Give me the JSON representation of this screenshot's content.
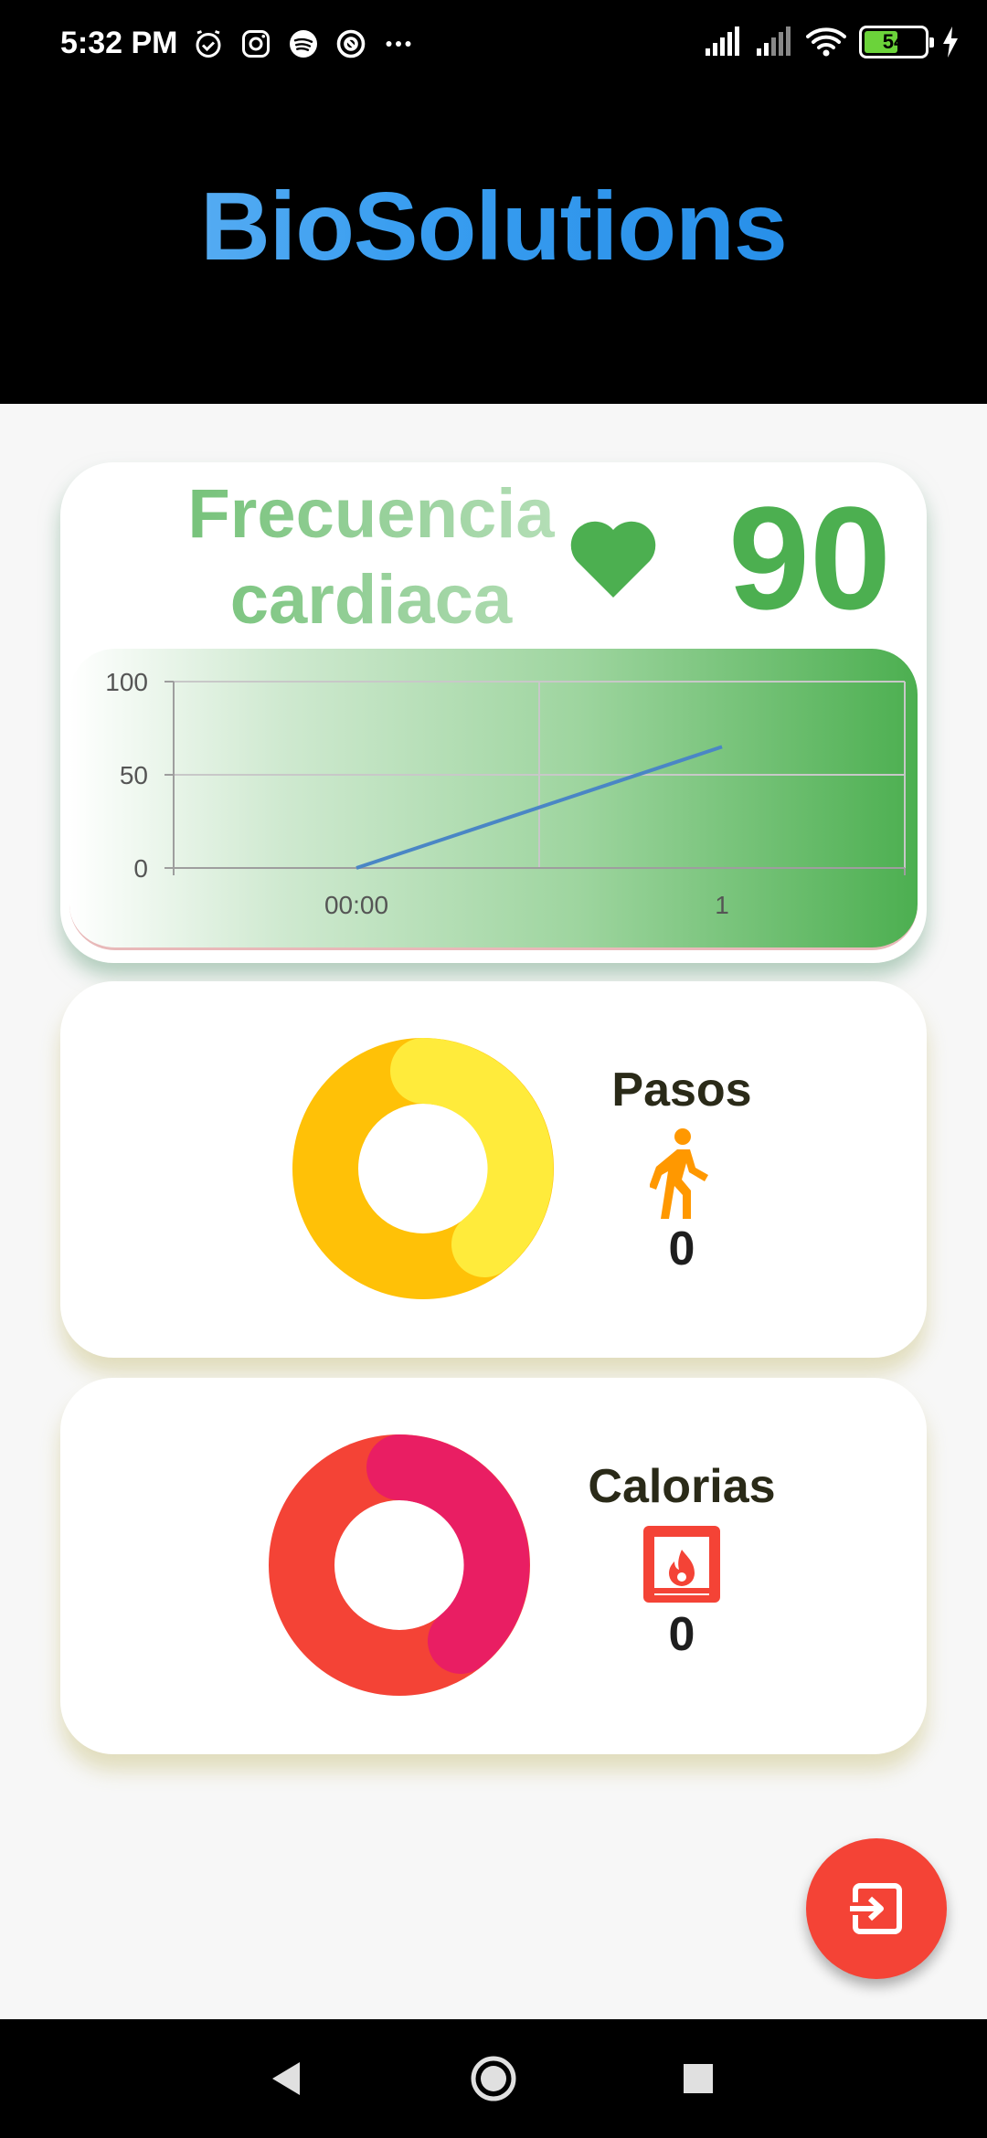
{
  "status_bar": {
    "time": "5:32 PM",
    "battery": "54",
    "icons_left": [
      "alarm-icon",
      "instagram-icon",
      "spotify-icon",
      "vpn-icon",
      "more-icon"
    ],
    "icons_right": [
      "signal-icon",
      "signal-icon",
      "wifi-icon",
      "battery-icon",
      "charging-icon"
    ]
  },
  "header": {
    "title": "BioSolutions"
  },
  "heart_card": {
    "title_line1": "Frecuencia",
    "title_line2": "cardiaca",
    "icon": "heart-icon",
    "value": "90"
  },
  "chart_data": {
    "type": "line",
    "x_tick_labels": [
      "00:00",
      "1"
    ],
    "y_tick_labels": [
      "100",
      "50",
      "0"
    ],
    "ylim": [
      0,
      100
    ],
    "x": [
      0,
      1
    ],
    "values": [
      0,
      65
    ],
    "grid": true
  },
  "steps_card": {
    "label": "Pasos",
    "icon": "walk-icon",
    "value": "0",
    "colors": {
      "main": "#FFC107",
      "accent": "#FFEB3B"
    }
  },
  "calories_card": {
    "label": "Calorias",
    "icon": "fireplace-icon",
    "value": "0",
    "colors": {
      "main": "#F44336",
      "accent": "#E91E63"
    }
  },
  "fab": {
    "icon": "logout-icon",
    "color": "#F44336"
  },
  "nav_bar": {
    "buttons": [
      "back-icon",
      "home-icon",
      "recents-icon"
    ]
  }
}
